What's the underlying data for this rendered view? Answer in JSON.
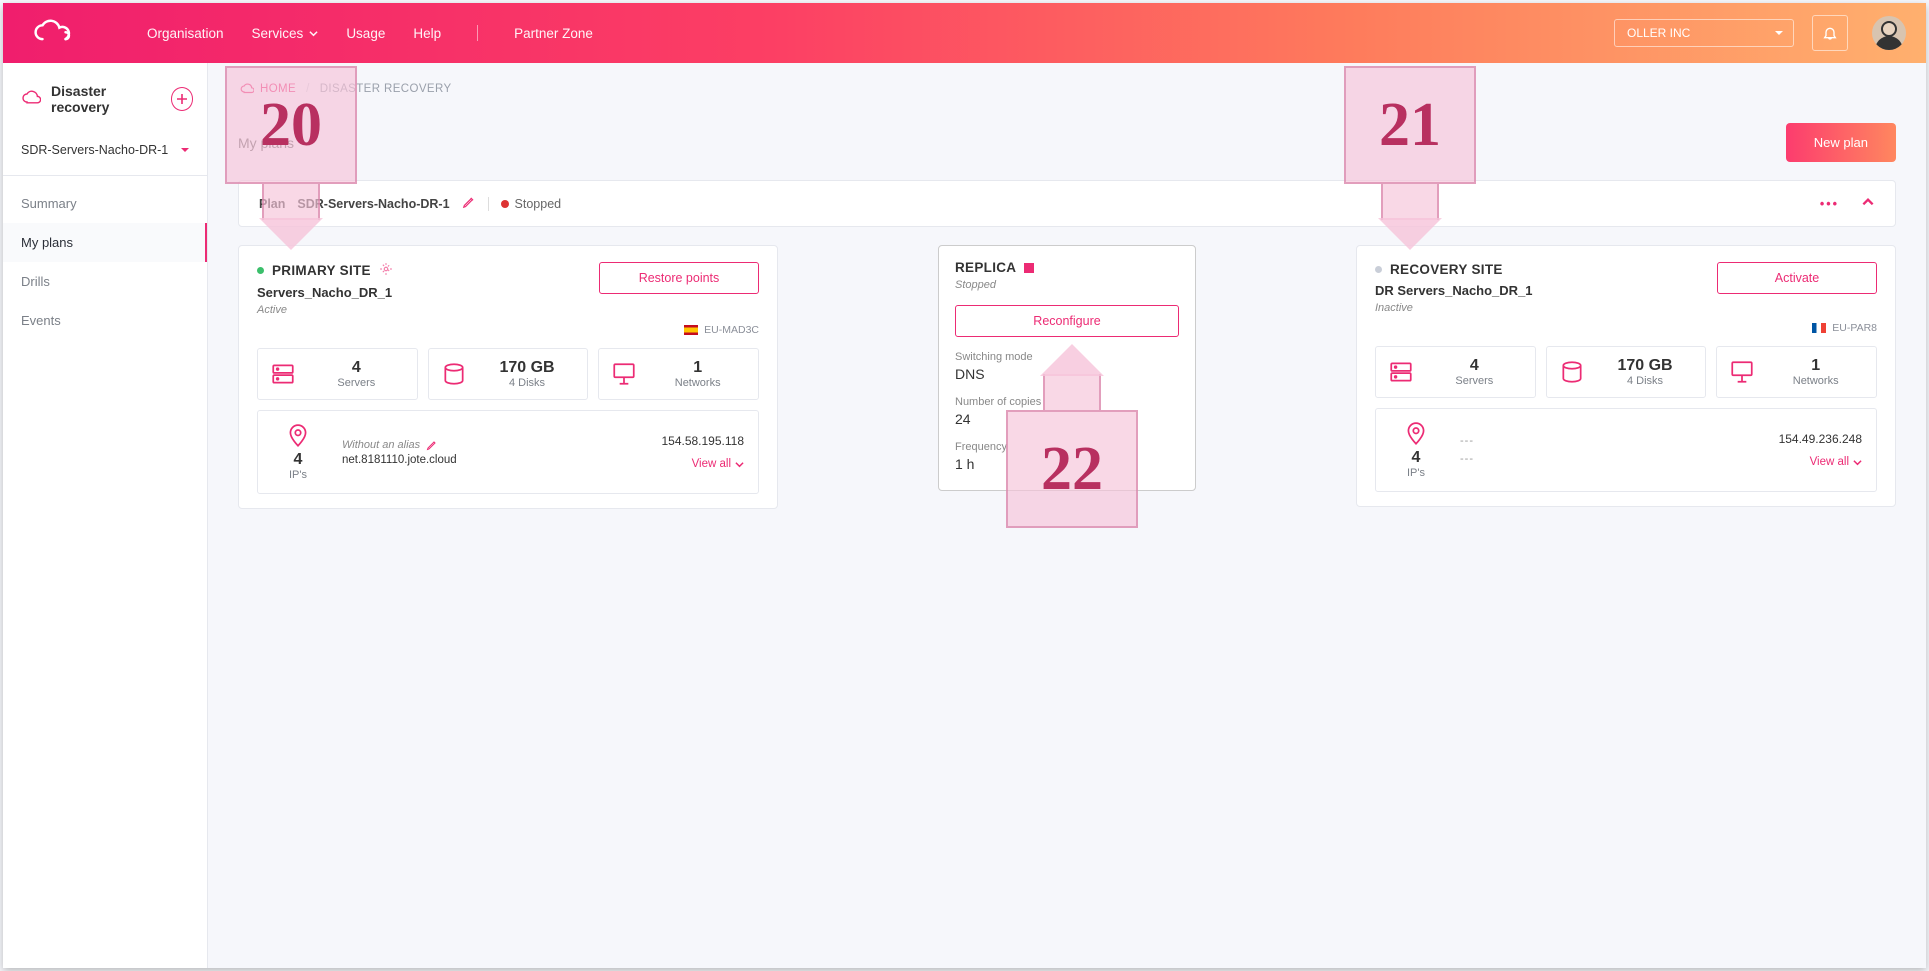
{
  "topbar": {
    "nav": {
      "organisation": "Organisation",
      "services": "Services",
      "usage": "Usage",
      "help": "Help",
      "partner": "Partner Zone"
    },
    "org_select": "OLLER INC"
  },
  "sidebar": {
    "title": "Disaster recovery",
    "plan_select": "SDR-Servers-Nacho-DR-1",
    "nav": {
      "summary": "Summary",
      "myplans": "My plans",
      "drills": "Drills",
      "events": "Events"
    }
  },
  "breadcrumb": {
    "home": "HOME",
    "current": "DISASTER RECOVERY"
  },
  "page": {
    "title": "My plans",
    "new_plan": "New plan"
  },
  "planbar": {
    "prefix": "Plan",
    "name": "SDR-Servers-Nacho-DR-1",
    "status": "Stopped"
  },
  "primary": {
    "heading": "PRIMARY SITE",
    "name": "Servers_Nacho_DR_1",
    "status": "Active",
    "button": "Restore points",
    "region": "EU-MAD3C",
    "metrics": {
      "servers_val": "4",
      "servers_lbl": "Servers",
      "storage_val": "170 GB",
      "storage_lbl": "4 Disks",
      "networks_val": "1",
      "networks_lbl": "Networks"
    },
    "ips": {
      "val": "4",
      "lbl": "IP's",
      "alias_label": "Without an alias",
      "alias_val": "net.8181110.jote.cloud",
      "ip": "154.58.195.118",
      "viewall": "View all"
    }
  },
  "replica": {
    "heading": "REPLICA",
    "status": "Stopped",
    "button": "Reconfigure",
    "switch_lbl": "Switching mode",
    "switch_val": "DNS",
    "copies_lbl": "Number of copies",
    "copies_val": "24",
    "freq_lbl": "Frequency",
    "freq_val": "1 h"
  },
  "recovery": {
    "heading": "RECOVERY SITE",
    "name": "DR Servers_Nacho_DR_1",
    "status": "Inactive",
    "button": "Activate",
    "region": "EU-PAR8",
    "metrics": {
      "servers_val": "4",
      "servers_lbl": "Servers",
      "storage_val": "170 GB",
      "storage_lbl": "4 Disks",
      "networks_val": "1",
      "networks_lbl": "Networks"
    },
    "ips": {
      "val": "4",
      "lbl": "IP's",
      "dashes": "---",
      "ip": "154.49.236.248",
      "viewall": "View all"
    }
  },
  "annotations": {
    "a20": "20",
    "a21": "21",
    "a22": "22"
  }
}
